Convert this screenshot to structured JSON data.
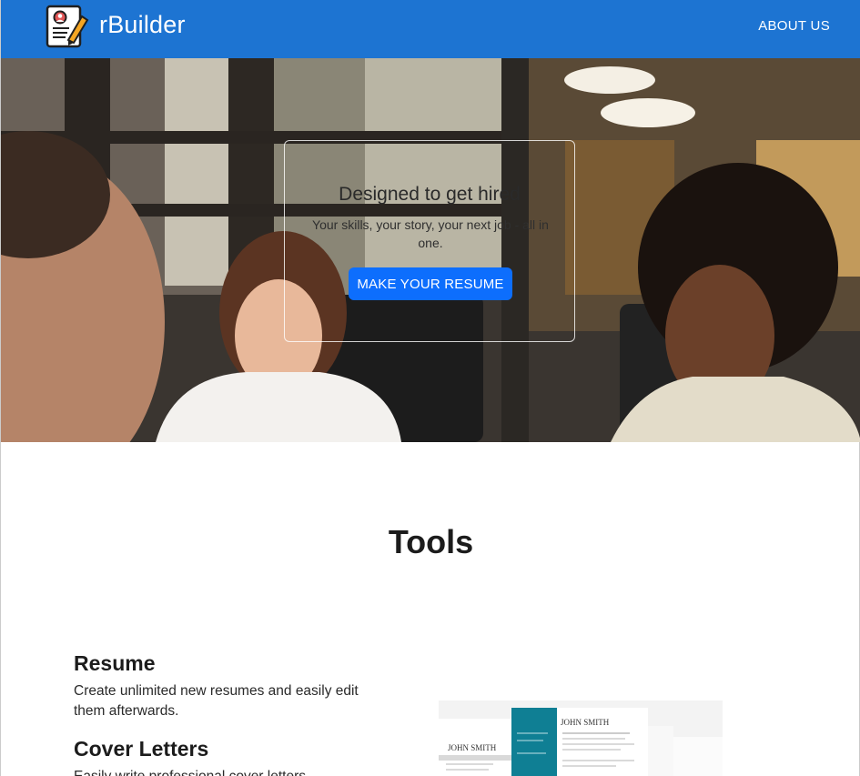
{
  "navbar": {
    "brand": "rBuilder",
    "logo_icon": "resume-edit-icon",
    "about_link": "ABOUT US",
    "color": "#1d74d2"
  },
  "hero": {
    "title": "Designed to get hired",
    "subtitle": "Your skills, your story, your next job - all in one.",
    "cta_label": "MAKE YOUR RESUME",
    "cta_color": "#0d6efd"
  },
  "tools": {
    "heading": "Tools",
    "items": [
      {
        "title": "Resume",
        "description": "Create unlimited new resumes and easily edit them afterwards."
      },
      {
        "title": "Cover Letters",
        "description": "Easily write professional cover letters."
      }
    ],
    "preview": {
      "name_left": "JOHN SMITH",
      "name_right": "JOHN SMITH"
    }
  }
}
